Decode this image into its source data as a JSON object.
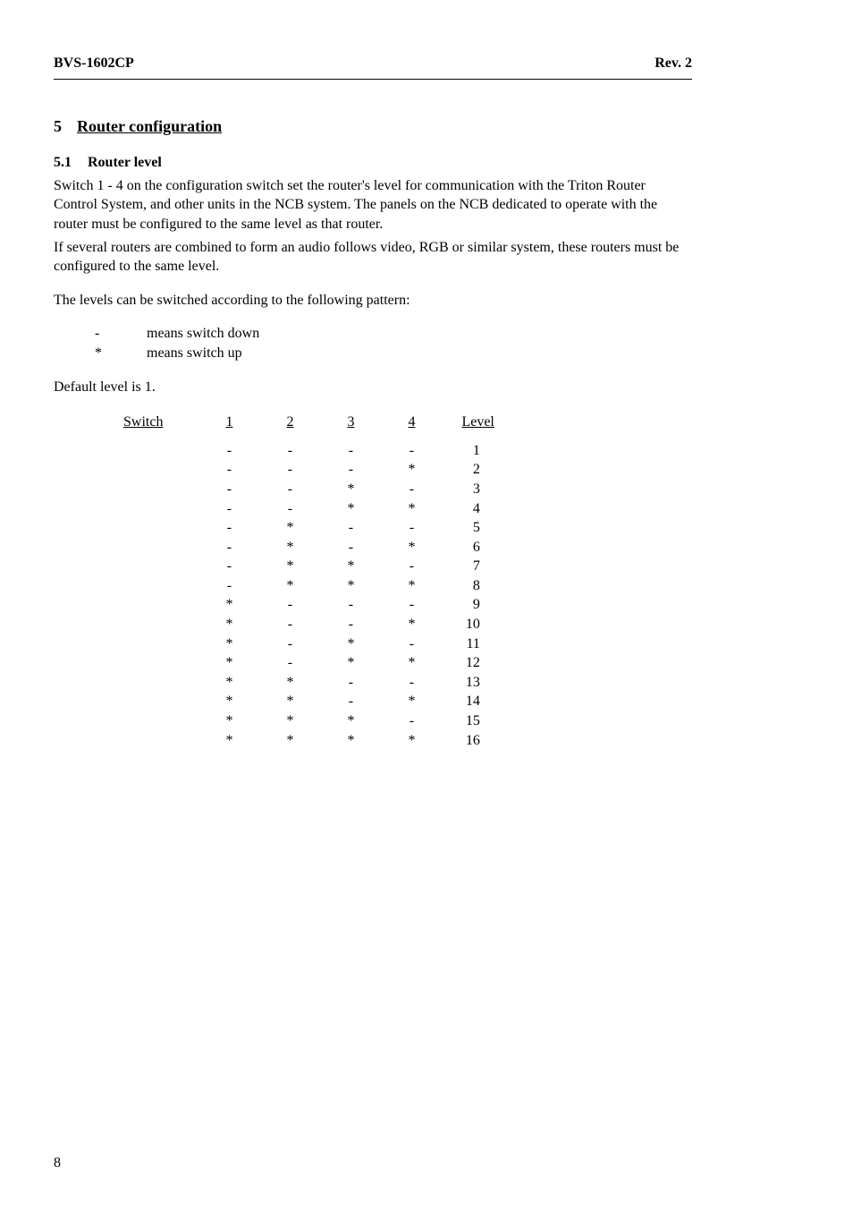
{
  "doc_header_left": "BVS-1602CP",
  "doc_header_right": "Rev. 2",
  "section_number": "5",
  "section_title": "Router configuration",
  "subsection_number": "5.1",
  "subsection_title": "Router level",
  "para1": "Switch 1 - 4 on the configuration switch set the router's level for communication with the Triton Router Control System, and other units in the NCB system. The panels on the NCB dedicated to operate with the router must be configured to the same level as that router.",
  "para2": "If several routers are combined to form an audio follows video, RGB or similar system, these routers must be configured to the same level.",
  "para3": "The levels can be switched according to the following pattern:",
  "legend": [
    {
      "sym": "-",
      "desc": "means switch down"
    },
    {
      "sym": "*",
      "desc": "means switch up"
    }
  ],
  "default_text": "Default level is 1.",
  "table_headers": {
    "label": "Switch",
    "c1": "1",
    "c2": "2",
    "c3": "3",
    "c4": "4",
    "level": "Level"
  },
  "chart_data": {
    "type": "table",
    "title": "Switch level pattern",
    "columns": [
      "Switch 1",
      "Switch 2",
      "Switch 3",
      "Switch 4",
      "Level"
    ],
    "rows": [
      [
        "-",
        "-",
        "-",
        "-",
        1
      ],
      [
        "-",
        "-",
        "-",
        "*",
        2
      ],
      [
        "-",
        "-",
        "*",
        "-",
        3
      ],
      [
        "-",
        "-",
        "*",
        "*",
        4
      ],
      [
        "-",
        "*",
        "-",
        "-",
        5
      ],
      [
        "-",
        "*",
        "-",
        "*",
        6
      ],
      [
        "-",
        "*",
        "*",
        "-",
        7
      ],
      [
        "-",
        "*",
        "*",
        "*",
        8
      ],
      [
        "*",
        "-",
        "-",
        "-",
        9
      ],
      [
        "*",
        "-",
        "-",
        "*",
        10
      ],
      [
        "*",
        "-",
        "*",
        "-",
        11
      ],
      [
        "*",
        "-",
        "*",
        "*",
        12
      ],
      [
        "*",
        "*",
        "-",
        "-",
        13
      ],
      [
        "*",
        "*",
        "-",
        "*",
        14
      ],
      [
        "*",
        "*",
        "*",
        "-",
        15
      ],
      [
        "*",
        "*",
        "*",
        "*",
        16
      ]
    ]
  },
  "page_number": "8"
}
